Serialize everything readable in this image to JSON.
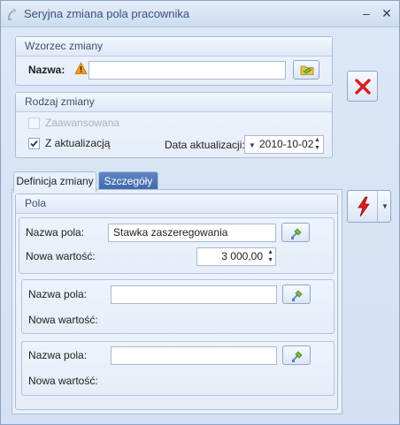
{
  "window": {
    "title": "Seryjna zmiana pola pracownika",
    "minimize_glyph": "–",
    "close_glyph": "✕"
  },
  "wzorzec": {
    "header": "Wzorzec zmiany",
    "nazwa_label": "Nazwa:",
    "nazwa_value": "",
    "warning_icon": "warning-icon",
    "lookup_icon": "folder-icon"
  },
  "rodzaj": {
    "header": "Rodzaj zmiany",
    "zaawansowana_label": "Zaawansowana",
    "zaawansowana_checked": false,
    "aktualizacja_label": "Z aktualizacją",
    "aktualizacja_checked": true,
    "data_label": "Data aktualizacji:",
    "data_value": "2010-10-02"
  },
  "tabs": [
    {
      "label": "Definicja zmiany",
      "active": true
    },
    {
      "label": "Szczegóły",
      "active": false
    }
  ],
  "pola": {
    "header": "Pola",
    "rows": [
      {
        "nazwa_label": "Nazwa pola:",
        "nazwa_value": "Stawka zaszeregowania",
        "wartosc_label": "Nowa wartość:",
        "wartosc_value": "3 000,00"
      },
      {
        "nazwa_label": "Nazwa pola:",
        "nazwa_value": "",
        "wartosc_label": "Nowa wartość:",
        "wartosc_value": ""
      },
      {
        "nazwa_label": "Nazwa pola:",
        "nazwa_value": "",
        "wartosc_label": "Nowa wartość:",
        "wartosc_value": ""
      }
    ]
  },
  "actions": {
    "cancel_icon": "red-x-icon",
    "execute_icon": "lightning-icon"
  },
  "colors": {
    "accent": "#3e66a8",
    "cancel_red": "#d8201e",
    "warning_orange": "#f39a1e"
  }
}
